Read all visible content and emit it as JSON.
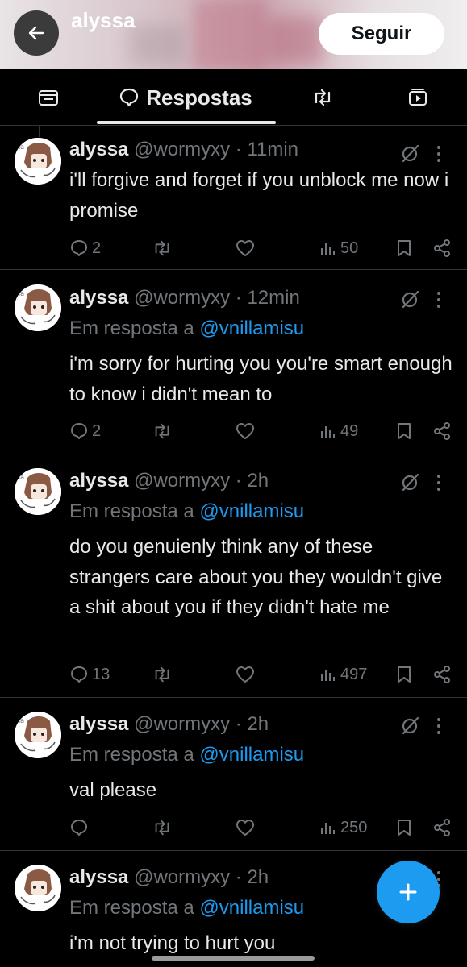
{
  "header": {
    "profile_name": "alyssa",
    "follow_label": "Seguir"
  },
  "tabs": [
    {
      "icon": "posts-icon",
      "label": ""
    },
    {
      "icon": "speech-bubble-icon",
      "label": "Respostas",
      "active": true
    },
    {
      "icon": "repost-icon",
      "label": ""
    },
    {
      "icon": "media-icon",
      "label": ""
    }
  ],
  "posts": [
    {
      "name": "alyssa",
      "handle": "@wormyxy",
      "time": "· 11min",
      "reply_prefix": "",
      "reply_to": "",
      "text": "i'll forgive and forget if you unblock me now i promise",
      "replies": "2",
      "reposts": "",
      "likes": "",
      "views": "50"
    },
    {
      "name": "alyssa",
      "handle": "@wormyxy",
      "time": "· 12min",
      "reply_prefix": "Em resposta a",
      "reply_to": "@vnillamisu",
      "text": "i'm sorry for hurting you you're smart enough to know i didn't mean to",
      "replies": "2",
      "reposts": "",
      "likes": "",
      "views": "49"
    },
    {
      "name": "alyssa",
      "handle": "@wormyxy",
      "time": "· 2h",
      "reply_prefix": "Em resposta a",
      "reply_to": "@vnillamisu",
      "text": "do you genuienly think any of these strangers care about you they wouldn't give a shit about you if they didn't hate me",
      "replies": "13",
      "reposts": "",
      "likes": "",
      "views": "497"
    },
    {
      "name": "alyssa",
      "handle": "@wormyxy",
      "time": "· 2h",
      "reply_prefix": "Em resposta a",
      "reply_to": "@vnillamisu",
      "text": "val please",
      "replies": "",
      "reposts": "",
      "likes": "",
      "views": "250"
    },
    {
      "name": "alyssa",
      "handle": "@wormyxy",
      "time": "· 2h",
      "reply_prefix": "Em resposta a",
      "reply_to": "@vnillamisu",
      "text": "i'm not trying to hurt you",
      "replies": "",
      "reposts": "",
      "likes": "",
      "views": ""
    }
  ],
  "colors": {
    "accent": "#1d9bf0",
    "background": "#000000",
    "text_primary": "#e7e9ea",
    "text_secondary": "#71767b",
    "divider": "#2f3336"
  }
}
